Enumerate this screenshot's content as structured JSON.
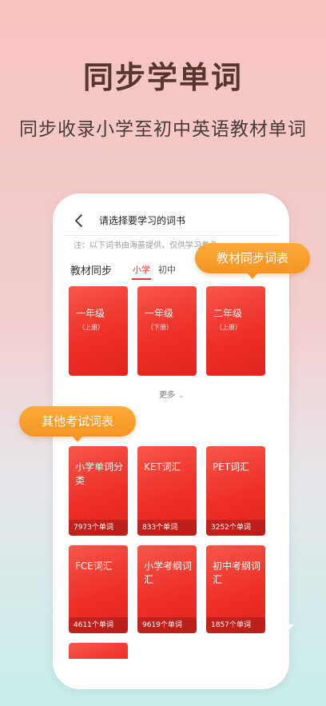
{
  "hero": {
    "title": "同步学单词",
    "subtitle": "同步收录小学至初中英语教材单词"
  },
  "screen": {
    "nav_title": "请选择要学习的词书",
    "notice": "注：以下词书由海苗提供，仅供学习参考",
    "section_title": "教材同步",
    "tabs": [
      {
        "label": "小学",
        "active": true
      },
      {
        "label": "初中",
        "active": false
      }
    ],
    "textbook_cards": [
      {
        "label": "一年级",
        "sub": "（上册）"
      },
      {
        "label": "一年级",
        "sub": "（下册）"
      },
      {
        "label": "二年级",
        "sub": "（上册）"
      }
    ],
    "more_label": "更多",
    "exam_cards": [
      {
        "label": "小学单词分类",
        "count": "7973个单词"
      },
      {
        "label": "KET词汇",
        "count": "833个单词"
      },
      {
        "label": "PET词汇",
        "count": "3252个单词"
      },
      {
        "label": "FCE词汇",
        "count": "4611个单词"
      },
      {
        "label": "小学考纲词汇",
        "count": "9619个单词"
      },
      {
        "label": "初中考纲词汇",
        "count": "1857个单词"
      }
    ]
  },
  "callouts": {
    "textbook": "教材同步词表",
    "exam": "其他考试词表"
  },
  "colors": {
    "accent_red": "#e4352e",
    "callout_orange": "#f59423",
    "title_brown": "#5a3433"
  }
}
